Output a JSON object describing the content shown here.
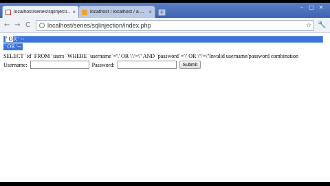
{
  "tabs": [
    {
      "title": "localhost/series/sqlinjecti...",
      "close": "×"
    },
    {
      "title": "localhost / localhost / a ...",
      "close": "×"
    }
  ],
  "new_tab_label": "+",
  "window_controls": [
    "–",
    "□",
    "×"
  ],
  "toolbar": {
    "back": "←",
    "forward": "→",
    "reload": "C",
    "url": "localhost/series/sqlinjection/index.php",
    "star": "☆",
    "wrench": "🔧"
  },
  "page": {
    "selected_line1_start": "' O",
    "selected_line1_rest": "R ' --",
    "selected_line2": "' OR '--",
    "query_text": "SELECT `id` FROM `users` WHERE `username`='\\' OR \\'\\'=\\'' AND `password`='\\' OR \\'\\'=\\''Invalid username/password combination",
    "username_label": "Username:",
    "username_value": "",
    "password_label": "Password:",
    "password_value": "",
    "submit_label": "Submit"
  }
}
